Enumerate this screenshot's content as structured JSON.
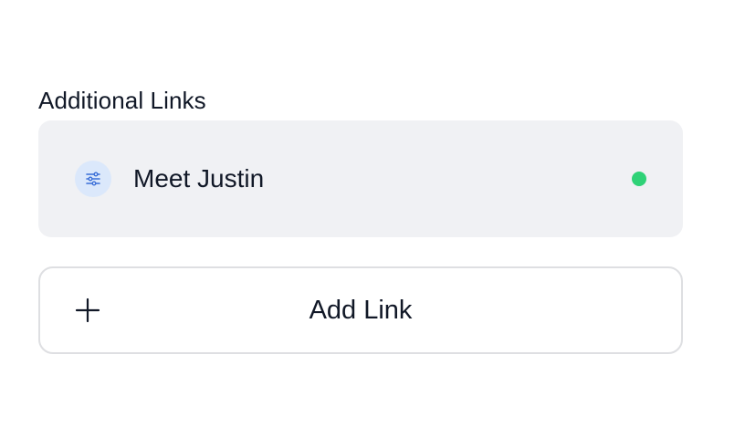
{
  "section": {
    "title": "Additional Links"
  },
  "links": [
    {
      "label": "Meet Justin",
      "icon": "sliders-icon",
      "status": "active",
      "status_color": "#2fd277"
    }
  ],
  "add_link": {
    "label": "Add Link",
    "icon": "plus-icon"
  },
  "colors": {
    "card_background": "#f0f1f4",
    "icon_background": "#dbe8fb",
    "icon_accent": "#3b6fd8",
    "text": "#111827",
    "border": "#dedfe2"
  }
}
